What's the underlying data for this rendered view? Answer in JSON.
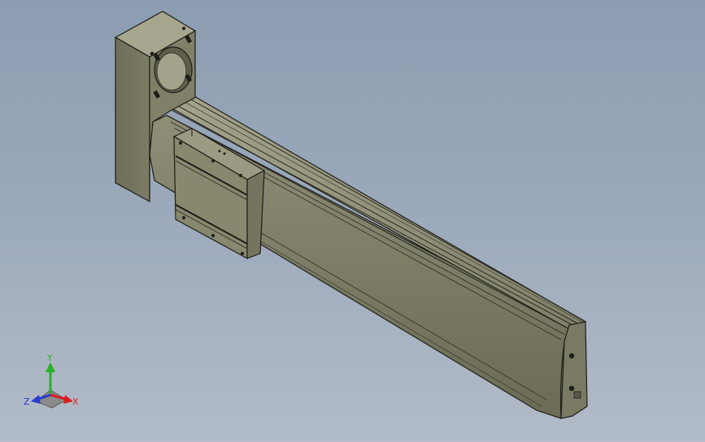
{
  "viewport": {
    "background_top": "#8d9db1",
    "background_bottom": "#b3bcc8"
  },
  "model": {
    "part_color": "#85856f",
    "edge_color": "#1e1e18"
  },
  "triad": {
    "x_label": "X",
    "y_label": "Y",
    "z_label": "Z",
    "x_color": "#d82020",
    "y_color": "#2ab02a",
    "z_color": "#2a3bd0"
  }
}
